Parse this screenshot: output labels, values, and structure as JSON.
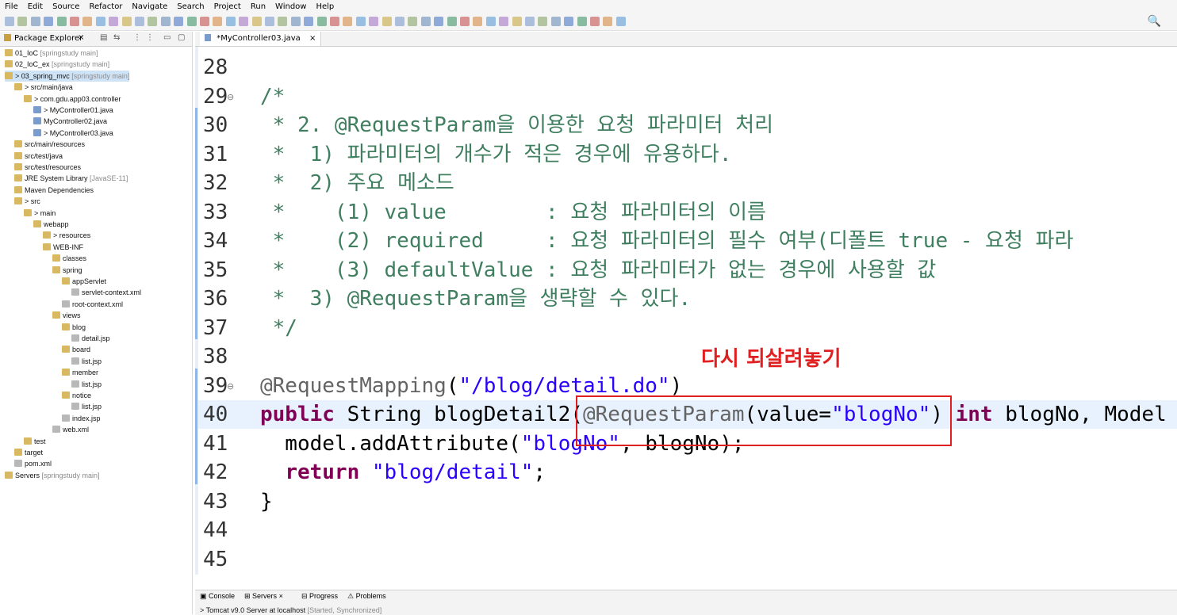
{
  "menu": [
    "File",
    "Edit",
    "Source",
    "Refactor",
    "Navigate",
    "Search",
    "Project",
    "Run",
    "Window",
    "Help"
  ],
  "package_explorer": {
    "title": "Package Explorer",
    "rows": [
      {
        "indent": 0,
        "text": "01_IoC",
        "dec": "[springstudy main]"
      },
      {
        "indent": 0,
        "text": "02_IoC_ex",
        "dec": "[springstudy main]"
      },
      {
        "indent": 0,
        "text": "> 03_spring_mvc",
        "dec": "[springstudy main]",
        "selected": true
      },
      {
        "indent": 1,
        "text": "> src/main/java",
        "dec": ""
      },
      {
        "indent": 2,
        "text": "> com.gdu.app03.controller",
        "dec": ""
      },
      {
        "indent": 3,
        "text": "> MyController01.java",
        "dec": ""
      },
      {
        "indent": 3,
        "text": "MyController02.java",
        "dec": ""
      },
      {
        "indent": 3,
        "text": "> MyController03.java",
        "dec": ""
      },
      {
        "indent": 1,
        "text": "src/main/resources",
        "dec": ""
      },
      {
        "indent": 1,
        "text": "src/test/java",
        "dec": ""
      },
      {
        "indent": 1,
        "text": "src/test/resources",
        "dec": ""
      },
      {
        "indent": 1,
        "text": "JRE System Library",
        "dec": "[JavaSE-11]"
      },
      {
        "indent": 1,
        "text": "Maven Dependencies",
        "dec": ""
      },
      {
        "indent": 1,
        "text": "> src",
        "dec": ""
      },
      {
        "indent": 2,
        "text": "> main",
        "dec": ""
      },
      {
        "indent": 3,
        "text": "webapp",
        "dec": ""
      },
      {
        "indent": 4,
        "text": "> resources",
        "dec": ""
      },
      {
        "indent": 4,
        "text": "WEB-INF",
        "dec": ""
      },
      {
        "indent": 5,
        "text": "classes",
        "dec": ""
      },
      {
        "indent": 5,
        "text": "spring",
        "dec": ""
      },
      {
        "indent": 6,
        "text": "appServlet",
        "dec": ""
      },
      {
        "indent": 7,
        "text": "servlet-context.xml",
        "dec": ""
      },
      {
        "indent": 6,
        "text": "root-context.xml",
        "dec": ""
      },
      {
        "indent": 5,
        "text": "views",
        "dec": ""
      },
      {
        "indent": 6,
        "text": "blog",
        "dec": ""
      },
      {
        "indent": 7,
        "text": "detail.jsp",
        "dec": ""
      },
      {
        "indent": 6,
        "text": "board",
        "dec": ""
      },
      {
        "indent": 7,
        "text": "list.jsp",
        "dec": ""
      },
      {
        "indent": 6,
        "text": "member",
        "dec": ""
      },
      {
        "indent": 7,
        "text": "list.jsp",
        "dec": ""
      },
      {
        "indent": 6,
        "text": "notice",
        "dec": ""
      },
      {
        "indent": 7,
        "text": "list.jsp",
        "dec": ""
      },
      {
        "indent": 6,
        "text": "index.jsp",
        "dec": ""
      },
      {
        "indent": 5,
        "text": "web.xml",
        "dec": ""
      },
      {
        "indent": 2,
        "text": "test",
        "dec": ""
      },
      {
        "indent": 1,
        "text": "target",
        "dec": ""
      },
      {
        "indent": 1,
        "text": "pom.xml",
        "dec": ""
      },
      {
        "indent": 0,
        "text": "Servers",
        "dec": "[springstudy main]"
      }
    ]
  },
  "editor": {
    "tab_label": "*MyController03.java",
    "lines": [
      {
        "n": "28",
        "parts": []
      },
      {
        "n": "29",
        "parts": [
          [
            "cmt",
            "/*"
          ]
        ],
        "fold": true
      },
      {
        "n": "30",
        "parts": [
          [
            "cmt",
            " * 2. @RequestParam을 이용한 요청 파라미터 처리"
          ]
        ]
      },
      {
        "n": "31",
        "parts": [
          [
            "cmt",
            " *  1) 파라미터의 개수가 적은 경우에 유용하다."
          ]
        ]
      },
      {
        "n": "32",
        "parts": [
          [
            "cmt",
            " *  2) 주요 메소드"
          ]
        ]
      },
      {
        "n": "33",
        "parts": [
          [
            "cmt",
            " *    (1) value        : 요청 파라미터의 이름"
          ]
        ]
      },
      {
        "n": "34",
        "parts": [
          [
            "cmt",
            " *    (2) required     : 요청 파라미터의 필수 여부(디폴트 true - 요청 파라"
          ]
        ]
      },
      {
        "n": "35",
        "parts": [
          [
            "cmt",
            " *    (3) defaultValue : 요청 파라미터가 없는 경우에 사용할 값"
          ]
        ]
      },
      {
        "n": "36",
        "parts": [
          [
            "cmt",
            " *  3) @RequestParam을 생략할 수 있다."
          ]
        ]
      },
      {
        "n": "37",
        "parts": [
          [
            "cmt",
            " */"
          ]
        ]
      },
      {
        "n": "38",
        "parts": []
      },
      {
        "n": "39",
        "parts": [
          [
            "ann",
            "@RequestMapping"
          ],
          [
            "txt",
            "("
          ],
          [
            "str",
            "\"/blog/detail.do\""
          ],
          [
            "txt",
            ")"
          ]
        ],
        "fold": true
      },
      {
        "n": "40",
        "parts": [
          [
            "kw",
            "public"
          ],
          [
            "txt",
            " String blogDetail2("
          ],
          [
            "ann",
            "@RequestParam"
          ],
          [
            "txt",
            "(value="
          ],
          [
            "str",
            "\"blogNo\""
          ],
          [
            "txt",
            ") "
          ],
          [
            "kw",
            "int"
          ],
          [
            "txt",
            " blogNo, Model"
          ]
        ]
      },
      {
        "n": "41",
        "parts": [
          [
            "txt",
            "  model.addAttribute("
          ],
          [
            "str",
            "\"blogNo\""
          ],
          [
            "txt",
            ", blogNo);"
          ]
        ]
      },
      {
        "n": "42",
        "parts": [
          [
            "txt",
            "  "
          ],
          [
            "kw",
            "return"
          ],
          [
            "txt",
            " "
          ],
          [
            "str",
            "\"blog/detail\""
          ],
          [
            "txt",
            ";"
          ]
        ]
      },
      {
        "n": "43",
        "parts": [
          [
            "txt",
            "}"
          ]
        ]
      },
      {
        "n": "44",
        "parts": []
      },
      {
        "n": "45",
        "parts": []
      }
    ],
    "note": "다시 되살려놓기"
  },
  "bottom": {
    "tabs": [
      "Console",
      "Servers",
      "Progress",
      "Problems"
    ],
    "server_line": "> Tomcat v9.0 Server at localhost",
    "server_status": "[Started, Synchronized]"
  },
  "colors": {
    "comment": "#3f7f5f",
    "keyword": "#7f0055",
    "string": "#2a00ff",
    "annotation": "#646464",
    "highlight": "#e02020"
  }
}
